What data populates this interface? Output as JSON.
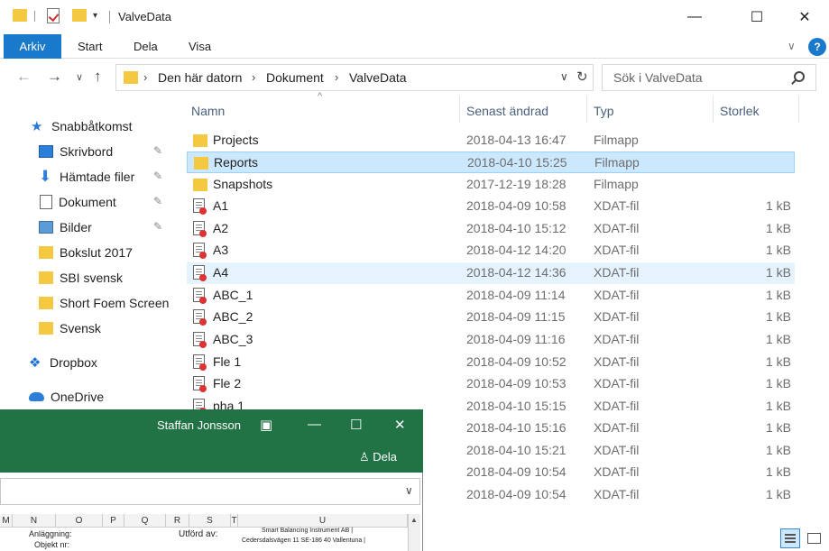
{
  "window": {
    "title": "ValveData",
    "minimize": "—",
    "maximize": "☐",
    "close": "✕"
  },
  "ribbon": {
    "tabs": [
      "Arkiv",
      "Start",
      "Dela",
      "Visa"
    ],
    "expand": "∨",
    "help": "?"
  },
  "address": {
    "segments": [
      "Den här datorn",
      "Dokument",
      "ValveData"
    ],
    "search_placeholder": "Sök i ValveData"
  },
  "sidebar": {
    "items": [
      {
        "label": "Snabbåtkomst",
        "icon": "star-icon",
        "pinned": false
      },
      {
        "label": "Skrivbord",
        "icon": "desktop-icon",
        "pinned": true
      },
      {
        "label": "Hämtade filer",
        "icon": "download-icon",
        "pinned": true
      },
      {
        "label": "Dokument",
        "icon": "document-icon",
        "pinned": true
      },
      {
        "label": "Bilder",
        "icon": "pictures-icon",
        "pinned": true
      },
      {
        "label": "Bokslut 2017",
        "icon": "folder-icon",
        "pinned": false
      },
      {
        "label": "SBI svensk",
        "icon": "folder-icon",
        "pinned": false
      },
      {
        "label": "Short Foem Screen",
        "icon": "folder-icon",
        "pinned": false
      },
      {
        "label": "Svensk",
        "icon": "folder-icon",
        "pinned": false
      },
      {
        "label": "Dropbox",
        "icon": "dropbox-icon",
        "pinned": false
      },
      {
        "label": "OneDrive",
        "icon": "onedrive-icon",
        "pinned": false
      }
    ]
  },
  "columns": {
    "name": "Namn",
    "modified": "Senast ändrad",
    "type": "Typ",
    "size": "Storlek"
  },
  "files": [
    {
      "name": "Projects",
      "modified": "2018-04-13 16:47",
      "type": "Filmapp",
      "size": "",
      "kind": "folder"
    },
    {
      "name": "Reports",
      "modified": "2018-04-10 15:25",
      "type": "Filmapp",
      "size": "",
      "kind": "folder",
      "state": "selected"
    },
    {
      "name": "Snapshots",
      "modified": "2017-12-19 18:28",
      "type": "Filmapp",
      "size": "",
      "kind": "folder"
    },
    {
      "name": "A1",
      "modified": "2018-04-09 10:58",
      "type": "XDAT-fil",
      "size": "1 kB",
      "kind": "file"
    },
    {
      "name": "A2",
      "modified": "2018-04-10 15:12",
      "type": "XDAT-fil",
      "size": "1 kB",
      "kind": "file"
    },
    {
      "name": "A3",
      "modified": "2018-04-12 14:20",
      "type": "XDAT-fil",
      "size": "1 kB",
      "kind": "file"
    },
    {
      "name": "A4",
      "modified": "2018-04-12 14:36",
      "type": "XDAT-fil",
      "size": "1 kB",
      "kind": "file",
      "state": "hover"
    },
    {
      "name": "ABC_1",
      "modified": "2018-04-09 11:14",
      "type": "XDAT-fil",
      "size": "1 kB",
      "kind": "file"
    },
    {
      "name": "ABC_2",
      "modified": "2018-04-09 11:15",
      "type": "XDAT-fil",
      "size": "1 kB",
      "kind": "file"
    },
    {
      "name": "ABC_3",
      "modified": "2018-04-09 11:16",
      "type": "XDAT-fil",
      "size": "1 kB",
      "kind": "file"
    },
    {
      "name": "Fle 1",
      "modified": "2018-04-09 10:52",
      "type": "XDAT-fil",
      "size": "1 kB",
      "kind": "file"
    },
    {
      "name": "Fle 2",
      "modified": "2018-04-09 10:53",
      "type": "XDAT-fil",
      "size": "1 kB",
      "kind": "file"
    },
    {
      "name": "pha 1",
      "modified": "2018-04-10 15:15",
      "type": "XDAT-fil",
      "size": "1 kB",
      "kind": "file"
    },
    {
      "name": "",
      "modified": "2018-04-10 15:16",
      "type": "XDAT-fil",
      "size": "1 kB",
      "kind": "hidden"
    },
    {
      "name": "",
      "modified": "2018-04-10 15:21",
      "type": "XDAT-fil",
      "size": "1 kB",
      "kind": "hidden"
    },
    {
      "name": "",
      "modified": "2018-04-09 10:54",
      "type": "XDAT-fil",
      "size": "1 kB",
      "kind": "hidden"
    },
    {
      "name": "",
      "modified": "2018-04-09 10:54",
      "type": "XDAT-fil",
      "size": "1 kB",
      "kind": "hidden"
    }
  ],
  "excel": {
    "user": "Staffan Jonsson",
    "share": "Dela",
    "columns": [
      "M",
      "N",
      "O",
      "P",
      "Q",
      "R",
      "S",
      "T",
      "U"
    ],
    "cells": {
      "anlaggning": "Anläggning:",
      "objekt": "Objekt nr:",
      "utford": "Utförd av:",
      "company": "Smart Balancing Instrument AB |",
      "address": "Cedersdalsvägen 11 SE-186 40 Vallentuna |"
    }
  },
  "colors": {
    "accent": "#1979ca",
    "excel_green": "#217346",
    "selected_bg": "#cce8ff",
    "folder": "#f5c842"
  }
}
